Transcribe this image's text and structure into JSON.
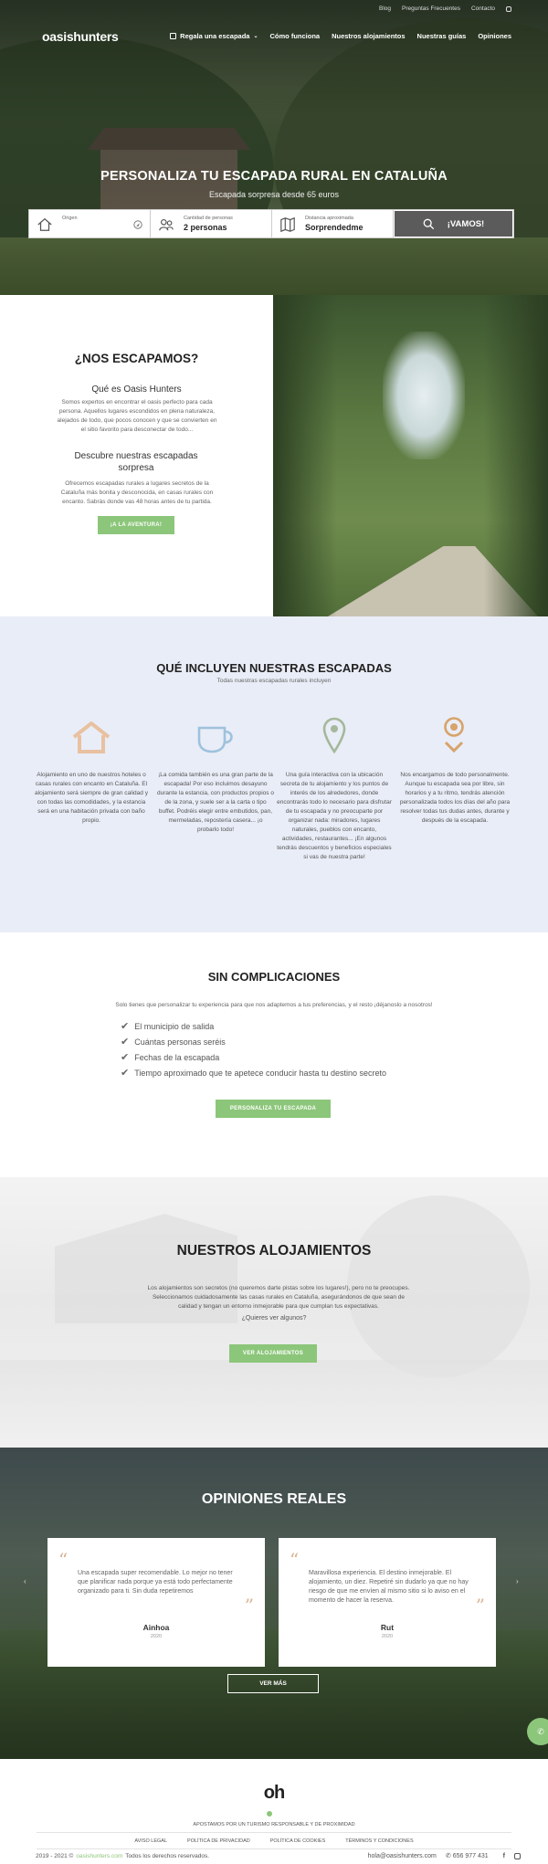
{
  "topbar": {
    "blog": "Blog",
    "faq": "Preguntas Frecuentes",
    "contact": "Contacto"
  },
  "header": {
    "logo": "oasishunters",
    "nav": [
      "Regala una escapada",
      "Cómo funciona",
      "Nuestros alojamientos",
      "Nuestras guías",
      "Opiniones"
    ]
  },
  "hero": {
    "title": "PERSONALIZA TU ESCAPADA RURAL EN CATALUÑA",
    "subtitle": "Escapada sorpresa desde 65 euros",
    "search": {
      "origin_label": "Origen",
      "origin_value": "",
      "people_label": "Cantidad de personas",
      "people_value": "2 personas",
      "distance_label": "Distancia aproximada",
      "distance_value": "Sorprendedme",
      "button": "¡VAMOS!"
    }
  },
  "escapamos": {
    "title": "¿NOS ESCAPAMOS?",
    "h1": "Qué es Oasis Hunters",
    "p1": "Somos expertos en encontrar el oasis perfecto para cada persona. Aquellos lugares escondidos en plena naturaleza, alejados de todo, que pocos conocen y que se convierten en el sitio favorito para desconectar de todo...",
    "h2": "Descubre nuestras escapadas sorpresa",
    "p2": "Ofrecemos escapadas rurales a lugares secretos de la Cataluña más bonita y desconocida, en casas rurales con encanto. Sabrás donde vas 48 horas antes de tu partida.",
    "button": "¡A LA AVENTURA!"
  },
  "incluyen": {
    "title": "QUÉ INCLUYEN NUESTRAS ESCAPADAS",
    "subtitle": "Todas nuestras escapadas rurales incluyen",
    "items": [
      {
        "icon": "house-icon",
        "text": "Alojamiento en uno de nuestros hoteles o casas rurales con encanto en Cataluña. El alojamiento será siempre de gran calidad y con todas las comodidades, y la estancia será en una habitación privada con baño propio."
      },
      {
        "icon": "cup-icon",
        "text": "¡La comida también es una gran parte de la escapada! Por eso incluimos desayuno durante la estancia, con productos propios o de la zona, y suele ser a la carta o tipo buffet. Podréis elegir entre embutidos, pan, mermeladas, repostería casera... ¡o probarlo todo!"
      },
      {
        "icon": "map-pin-icon",
        "text": "Una guía interactiva con la ubicación secreta de tu alojamiento y los puntos de interés de los alrededores, donde encontrarás todo lo necesario para disfrutar de tu escapada y no preocuparte por organizar nada: miradores, lugares naturales, pueblos con encanto, actividades, restaurantes... ¡En algunos tendrás descuentos y beneficios especiales si vas de nuestra parte!"
      },
      {
        "icon": "location-heart-icon",
        "text": "Nos encargamos de todo personalmente. Aunque tu escapada sea por libre, sin horarios y a tu ritmo, tendrás atención personalizada todos los días del año para resolver todas tus dudas antes, durante y después de la escapada."
      }
    ]
  },
  "sin": {
    "title": "SIN COMPLICACIONES",
    "subtitle": "Solo tienes que personalizar tu experiencia para que nos adaptemos a tus preferencias, y el resto ¡déjanoslo a nosotros!",
    "checks": [
      "El municipio de salida",
      "Cuántas personas seréis",
      "Fechas de la escapada",
      "Tiempo aproximado que te apetece conducir hasta tu destino secreto"
    ],
    "button": "PERSONALIZA TU ESCAPADA"
  },
  "aloj": {
    "title": "NUESTROS ALOJAMIENTOS",
    "text": "Los alojamientos son secretos (no queremos darte pistas sobre los lugares!), pero no te preocupes. Seleccionamos cuidadosamente las casas rurales en Cataluña, asegurándonos de que sean de calidad y tengan un entorno inmejorable para que cumplan tus expectativas.",
    "question": "¿Quieres ver algunos?",
    "button": "VER ALOJAMIENTOS"
  },
  "opin": {
    "title": "OPINIONES REALES",
    "cards": [
      {
        "text": "Una escapada super recomendable. Lo mejor no tener que planificar nada porque ya está todo perfectamente organizado para ti. Sin duda repetiremos",
        "name": "Ainhoa",
        "year": "2020"
      },
      {
        "text": "Maravillosa experiencia. El destino inmejorable. El alojamiento, un diez. Repetiré sin dudarlo ya que no hay riesgo de que me envíen al mismo sitio si lo aviso en el momento de hacer la reserva.",
        "name": "Rut",
        "year": "2020"
      }
    ],
    "button": "VER MÁS"
  },
  "footer": {
    "logo": "oh",
    "tagline": "APOSTAMOS POR UN TURISMO RESPONSABLE Y DE PROXIMIDAD",
    "links": [
      "AVISO LEGAL",
      "POLÍTICA DE PRIVACIDAD",
      "POLÍTICA DE COOKIES",
      "TÉRMINOS Y CONDICIONES"
    ],
    "copy_pre": "2019 - 2021 ©",
    "copy_link": "oasishunters.com",
    "copy_post": "Todos los derechos reservados.",
    "email": "hola@oasishunters.com",
    "phone": "656 977 431"
  },
  "colors": {
    "green": "#8cc67a",
    "peach": "#e8c1a0",
    "blue": "#9fc2dc",
    "sage": "#a5b89b",
    "ochre": "#d7a36a"
  }
}
